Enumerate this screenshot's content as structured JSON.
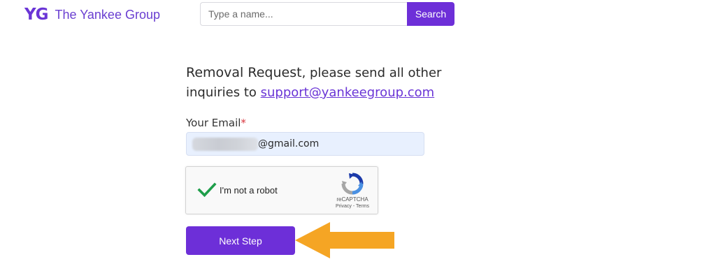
{
  "header": {
    "logo_mark": "YG",
    "logo_text": "The Yankee Group",
    "search": {
      "placeholder": "Type a name...",
      "button_label": "Search"
    }
  },
  "form": {
    "heading_lead": "Removal Request",
    "heading_rest": ", please send all other inquiries to ",
    "support_email": "support@yankeegroup.com",
    "email_label": "Your Email",
    "required_marker": "*",
    "email_value_visible": "@gmail.com",
    "captcha": {
      "label": "I'm not a robot",
      "brand": "reCAPTCHA",
      "links": "Privacy - Terms",
      "checked": true
    },
    "next_button": "Next Step"
  },
  "colors": {
    "brand_purple": "#6d2fd8",
    "link_purple": "#6a35d6",
    "arrow_orange": "#f5a524",
    "check_green": "#1e9e4a"
  },
  "icons": {
    "captcha_check": "checkmark-icon",
    "captcha_logo": "recaptcha-icon",
    "annotation": "arrow-left-icon"
  }
}
